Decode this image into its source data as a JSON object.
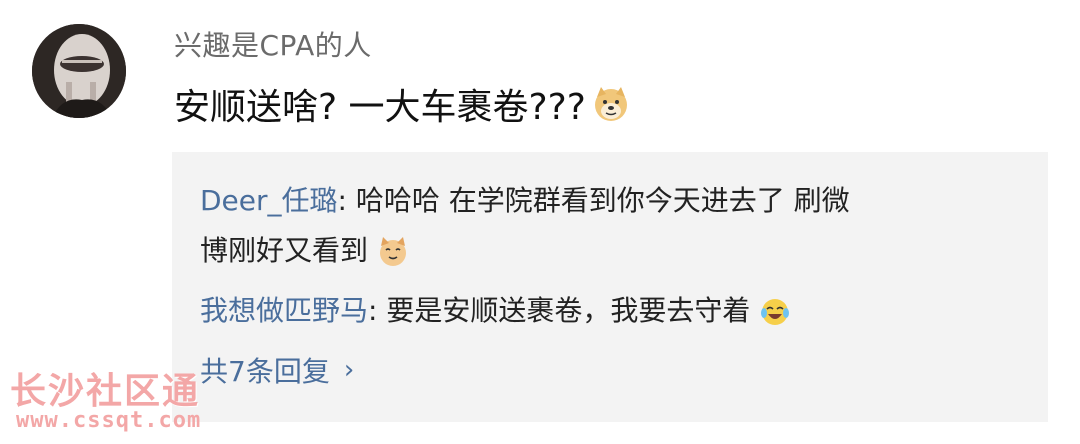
{
  "comment": {
    "username": "兴趣是CPA的人",
    "text": "安顺送啥? 一大车裹卷???",
    "emoji": "doge-emoji"
  },
  "replies": [
    {
      "name": "Deer_任璐",
      "separator": ": ",
      "text_line1": "哈哈哈 在学院群看到你今天进去了 刷微",
      "text_line2": "博刚好又看到",
      "emoji": "cat-emoji"
    },
    {
      "name": "我想做匹野马",
      "separator": ": ",
      "text": "要是安顺送裹卷，我要去守着",
      "emoji": "laugh-cry-emoji"
    }
  ],
  "more_replies": {
    "label": "共7条回复",
    "chevron": "›"
  },
  "watermark": {
    "cn": "长沙社区通",
    "url": "www.cssqt.com"
  }
}
